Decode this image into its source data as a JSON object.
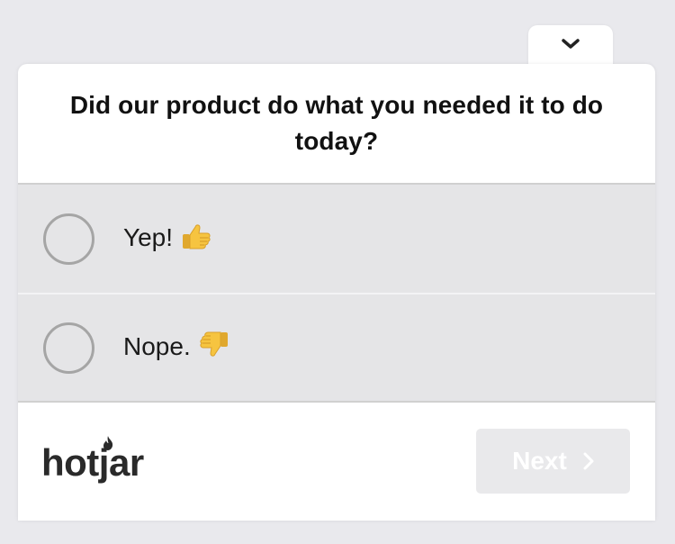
{
  "widget": {
    "collapse_icon": "chevron-down-icon",
    "question": "Did our product do what you needed it to do today?",
    "options": [
      {
        "label": "Yep!",
        "emoji": "thumbs-up-icon",
        "selected": false
      },
      {
        "label": "Nope.",
        "emoji": "thumbs-down-icon",
        "selected": false
      }
    ],
    "footer": {
      "logo": "hotjar",
      "next_label": "Next",
      "next_icon": "chevron-right-icon",
      "next_enabled": false
    }
  },
  "colors": {
    "page_background": "#e9e9ed",
    "card_background": "#ffffff",
    "option_background": "#e5e5e7",
    "radio_border": "#a5a5a5",
    "next_disabled_background": "#e9e9eb",
    "emoji_yellow": "#f6c440"
  }
}
